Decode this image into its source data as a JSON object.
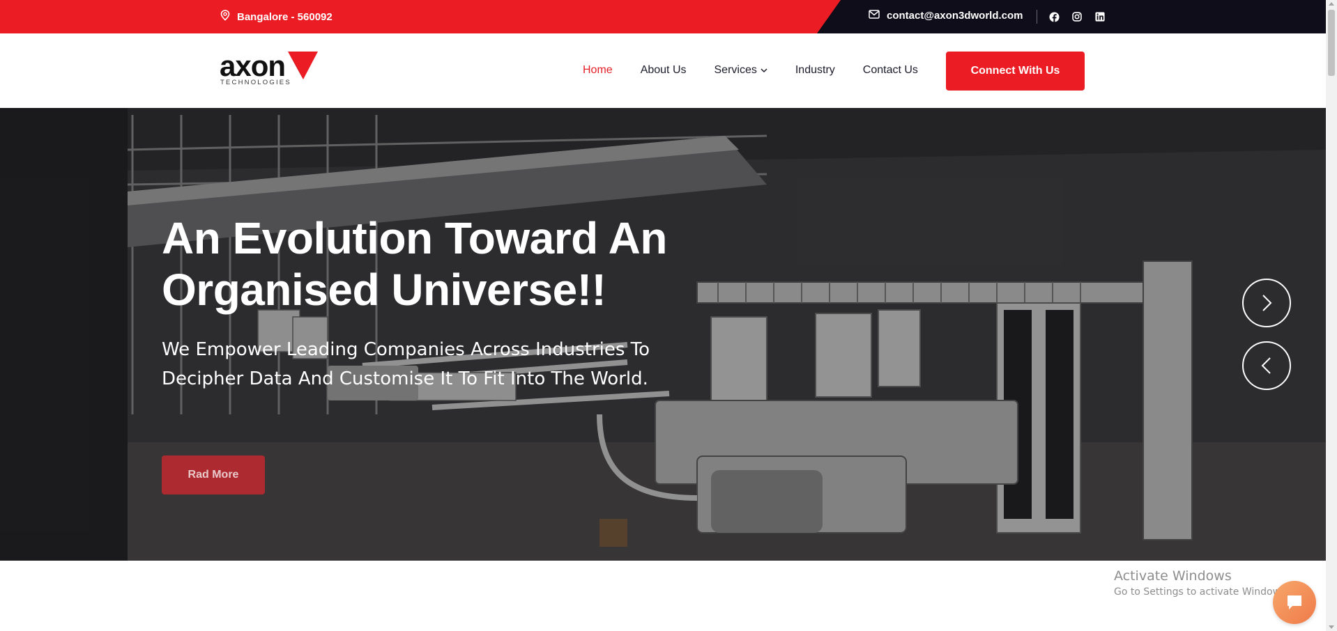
{
  "topbar": {
    "location": "Bangalore - 560092",
    "email": "contact@axon3dworld.com",
    "social": [
      "facebook-icon",
      "instagram-icon",
      "linkedin-icon"
    ],
    "colors": {
      "red": "#ec1c24",
      "dark": "#0f0d1a"
    }
  },
  "header": {
    "logo_text": "axon",
    "logo_sub": "TECHNOLOGIES",
    "nav": [
      {
        "label": "Home",
        "active": true
      },
      {
        "label": "About Us"
      },
      {
        "label": "Services",
        "dropdown": true
      },
      {
        "label": "Industry"
      },
      {
        "label": "Contact Us"
      }
    ],
    "cta_label": "Connect With Us"
  },
  "hero": {
    "title_line1": "An Evolution Toward An",
    "title_line2": "Organised Universe!!",
    "subtitle_line1": "We Empower Leading Companies Across Industries To",
    "subtitle_line2": "Decipher Data And Customise It To Fit Into The World.",
    "button_label": "Rad More",
    "next_icon": "chevron-right-icon",
    "prev_icon": "chevron-left-icon"
  },
  "watermark": {
    "title": "Activate Windows",
    "subtitle": "Go to Settings to activate Windows."
  },
  "chat": {
    "icon": "chat-bubble-icon",
    "color": "#ef7a4a"
  }
}
